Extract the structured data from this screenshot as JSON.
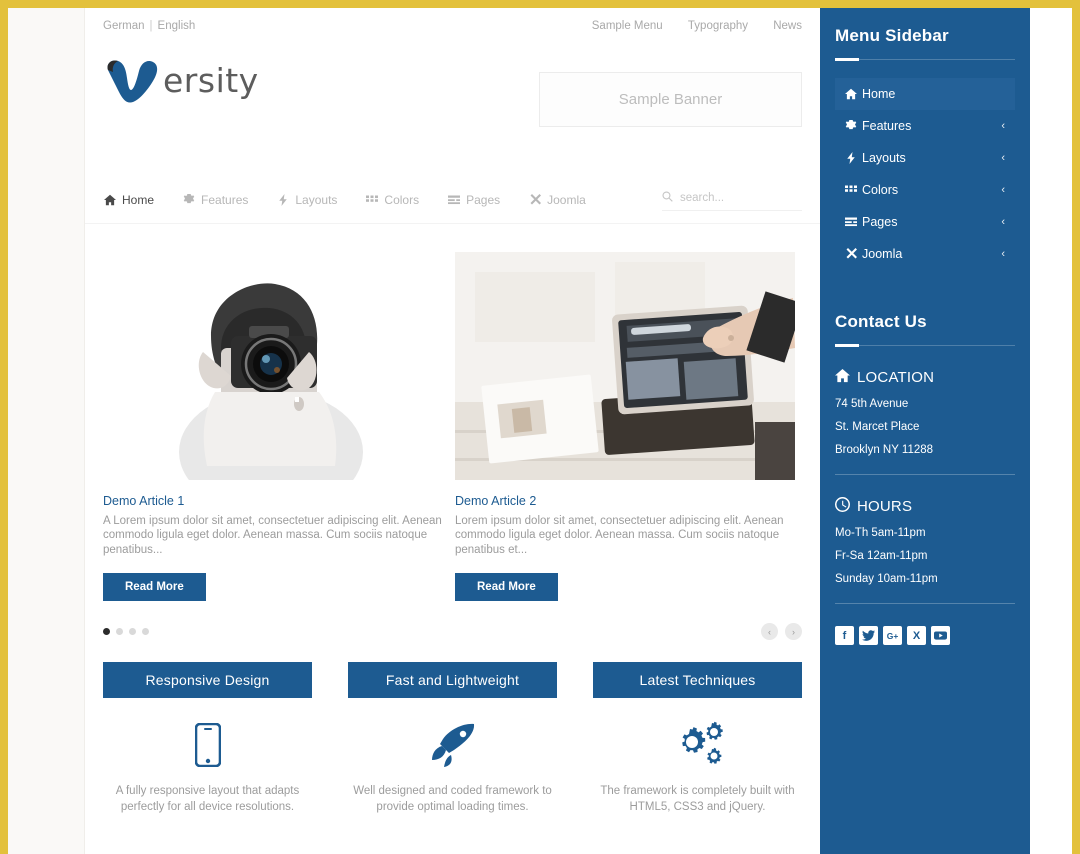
{
  "theme": {
    "accent": "#1d5b91",
    "page_border": "#e3c13c",
    "muted_text": "#9c9c9c"
  },
  "topbar": {
    "lang_german": "German",
    "lang_sep": "|",
    "lang_english": "English",
    "links": [
      "Sample Menu",
      "Typography",
      "News"
    ]
  },
  "brand": {
    "logo_letter": "v",
    "name": "ersity"
  },
  "banner": {
    "label": "Sample Banner"
  },
  "mainnav": {
    "items": [
      {
        "label": "Home",
        "icon": "home-icon",
        "active": true
      },
      {
        "label": "Features",
        "icon": "gear-icon",
        "active": false
      },
      {
        "label": "Layouts",
        "icon": "bolt-icon",
        "active": false
      },
      {
        "label": "Colors",
        "icon": "grid-icon",
        "active": false
      },
      {
        "label": "Pages",
        "icon": "list-icon",
        "active": false
      },
      {
        "label": "Joomla",
        "icon": "joomla-icon",
        "active": false
      }
    ]
  },
  "search": {
    "placeholder": "search...",
    "value": "",
    "icon": "search-icon"
  },
  "articles": [
    {
      "title": "Demo Article 1",
      "body": "A Lorem ipsum dolor sit amet, consectetuer adipiscing elit. Aenean commodo ligula eget dolor. Aenean massa. Cum sociis natoque penatibus...",
      "button": "Read More",
      "image": "photographer-bw-photo"
    },
    {
      "title": "Demo Article 2",
      "body": "Lorem ipsum dolor sit amet, consectetuer adipiscing elit. Aenean commodo ligula eget dolor. Aenean massa. Cum sociis natoque penatibus et...",
      "button": "Read More",
      "image": "tablet-on-desk-photo"
    }
  ],
  "carousel": {
    "dots": 4,
    "active_dot": 1,
    "prev": "‹",
    "next": "›"
  },
  "features": [
    {
      "title": "Responsive Design",
      "icon": "mobile-phone-icon",
      "text": "A fully responsive layout that adapts perfectly for all device resolutions."
    },
    {
      "title": "Fast and Lightweight",
      "icon": "rocket-icon",
      "text": "Well designed and coded framework to provide optimal loading times."
    },
    {
      "title": "Latest Techniques",
      "icon": "gears-icon",
      "text": "The framework is completely built with HTML5, CSS3 and jQuery."
    }
  ],
  "sidebar": {
    "menu_title": "Menu Sidebar",
    "menu_items": [
      {
        "label": "Home",
        "icon": "home-icon",
        "active": true,
        "chevron": "‹"
      },
      {
        "label": "Features",
        "icon": "gear-icon",
        "active": false,
        "chevron": "‹"
      },
      {
        "label": "Layouts",
        "icon": "bolt-icon",
        "active": false,
        "chevron": "‹"
      },
      {
        "label": "Colors",
        "icon": "grid-icon",
        "active": false,
        "chevron": "‹"
      },
      {
        "label": "Pages",
        "icon": "list-icon",
        "active": false,
        "chevron": "‹"
      },
      {
        "label": "Joomla",
        "icon": "joomla-icon",
        "active": false,
        "chevron": "‹"
      }
    ],
    "contact_title": "Contact Us",
    "location": {
      "heading": "LOCATION",
      "icon": "home-icon",
      "lines": [
        "74 5th Avenue",
        "St. Marcet Place",
        "Brooklyn NY 11288"
      ]
    },
    "hours": {
      "heading": "HOURS",
      "icon": "clock-icon",
      "lines": [
        "Mo-Th 5am-11pm",
        "Fr-Sa 12am-11pm",
        "Sunday 10am-11pm"
      ]
    },
    "social": [
      {
        "name": "facebook-icon",
        "glyph": "f"
      },
      {
        "name": "twitter-icon",
        "glyph": ""
      },
      {
        "name": "google-plus-icon",
        "glyph": "G+"
      },
      {
        "name": "xing-icon",
        "glyph": "X"
      },
      {
        "name": "youtube-icon",
        "glyph": ""
      }
    ]
  }
}
